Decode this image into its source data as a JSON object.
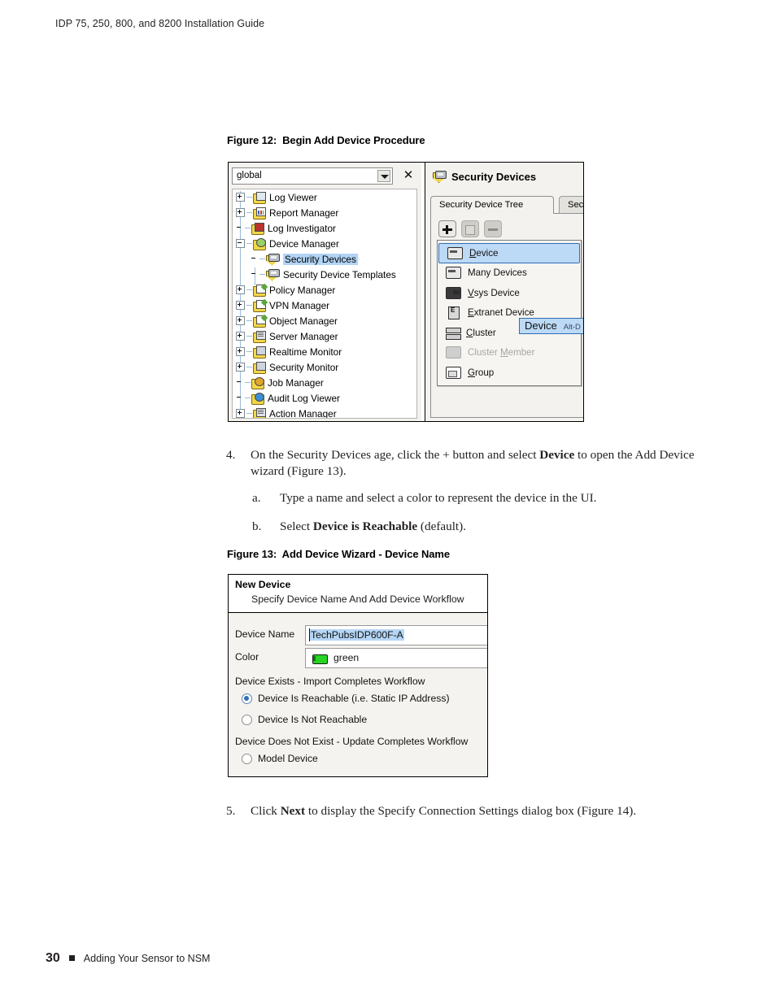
{
  "running_head": "IDP 75, 250, 800, and 8200 Installation Guide",
  "footer": {
    "page_number": "30",
    "section": "Adding Your Sensor to NSM"
  },
  "figure12": {
    "caption": "Figure 12:  Begin Add Device Procedure",
    "domain_selector": {
      "value": "global",
      "dropdown_icon": "chevron-down-icon",
      "close_icon": "close-icon"
    },
    "tree": [
      {
        "label": "Log Viewer",
        "expander": "plus",
        "indent": 1,
        "icon": "log-viewer-icon",
        "selected": false,
        "disabled": false
      },
      {
        "label": "Report Manager",
        "expander": "plus",
        "indent": 1,
        "icon": "report-manager-icon",
        "selected": false,
        "disabled": false
      },
      {
        "label": "Log Investigator",
        "expander": "none",
        "indent": 1,
        "icon": "log-investigator-icon",
        "selected": false,
        "disabled": false
      },
      {
        "label": "Device Manager",
        "expander": "minus",
        "indent": 1,
        "icon": "device-manager-icon",
        "selected": false,
        "disabled": false
      },
      {
        "label": "Security Devices",
        "expander": "none",
        "indent": 2,
        "icon": "security-devices-icon",
        "selected": true,
        "disabled": false
      },
      {
        "label": "Security Device Templates",
        "expander": "none",
        "indent": 2,
        "icon": "security-device-templates-icon",
        "selected": false,
        "disabled": false
      },
      {
        "label": "Policy Manager",
        "expander": "plus",
        "indent": 1,
        "icon": "policy-manager-icon",
        "selected": false,
        "disabled": false
      },
      {
        "label": "VPN Manager",
        "expander": "plus",
        "indent": 1,
        "icon": "vpn-manager-icon",
        "selected": false,
        "disabled": false
      },
      {
        "label": "Object Manager",
        "expander": "plus",
        "indent": 1,
        "icon": "object-manager-icon",
        "selected": false,
        "disabled": false
      },
      {
        "label": "Server Manager",
        "expander": "plus",
        "indent": 1,
        "icon": "server-manager-icon",
        "selected": false,
        "disabled": false
      },
      {
        "label": "Realtime Monitor",
        "expander": "plus",
        "indent": 1,
        "icon": "realtime-monitor-icon",
        "selected": false,
        "disabled": false
      },
      {
        "label": "Security Monitor",
        "expander": "plus",
        "indent": 1,
        "icon": "security-monitor-icon",
        "selected": false,
        "disabled": false
      },
      {
        "label": "Job Manager",
        "expander": "none",
        "indent": 1,
        "icon": "job-manager-icon",
        "selected": false,
        "disabled": false
      },
      {
        "label": "Audit Log Viewer",
        "expander": "none",
        "indent": 1,
        "icon": "audit-log-viewer-icon",
        "selected": false,
        "disabled": false
      },
      {
        "label": "Action Manager",
        "expander": "plus",
        "indent": 1,
        "icon": "action-manager-icon",
        "selected": false,
        "disabled": false
      }
    ],
    "panel": {
      "title": "Security Devices",
      "title_icon": "security-devices-icon",
      "tabs": [
        {
          "label": "Security Device Tree",
          "active": true
        },
        {
          "label": "Securi",
          "active": false
        }
      ],
      "toolbar": [
        {
          "name": "add-button",
          "glyph": "plus-icon",
          "disabled": false
        },
        {
          "name": "edit-button",
          "glyph": "pencil-icon",
          "disabled": true
        },
        {
          "name": "delete-button",
          "glyph": "minus-icon",
          "disabled": true
        }
      ],
      "add_menu": [
        {
          "label": "Device",
          "mnemonic": "D",
          "icon": "device-icon",
          "selected": true,
          "disabled": false
        },
        {
          "label": "Many Devices",
          "mnemonic": "",
          "icon": "many-devices-icon",
          "selected": false,
          "disabled": false
        },
        {
          "label": "Vsys Device",
          "mnemonic": "V",
          "icon": "vsys-device-icon",
          "selected": false,
          "disabled": false
        },
        {
          "label": "Extranet Device",
          "mnemonic": "E",
          "icon": "extranet-device-icon",
          "selected": false,
          "disabled": false
        },
        {
          "label": "Cluster",
          "mnemonic": "C",
          "icon": "cluster-icon",
          "selected": false,
          "disabled": false
        },
        {
          "label": "Cluster Member",
          "mnemonic": "M",
          "icon": "cluster-member-icon",
          "selected": false,
          "disabled": true
        },
        {
          "label": "Group",
          "mnemonic": "G",
          "icon": "group-icon",
          "selected": false,
          "disabled": false
        }
      ],
      "tooltip": {
        "label": "Device",
        "shortcut": "Alt-D"
      }
    }
  },
  "step4": {
    "marker": "4.",
    "text_1": "On the Security Devices age, click the  + button and select ",
    "bold_1": "Device",
    "text_2": " to open the Add Device wizard (Figure 13)."
  },
  "step4a": {
    "marker": "a.",
    "text": "Type a name and select a color to represent the device in the UI."
  },
  "step4b": {
    "marker": "b.",
    "text_1": "Select ",
    "bold_1": "Device is Reachable",
    "text_2": " (default)."
  },
  "step5": {
    "marker": "5.",
    "text_1": "Click ",
    "bold_1": "Next",
    "text_2": " to display the Specify Connection Settings dialog box (Figure 14)."
  },
  "figure13": {
    "caption": "Figure 13:  Add Device Wizard - Device Name",
    "wizard": {
      "title": "New Device",
      "subtitle": "Specify Device Name And Add Device Workflow",
      "fields": [
        {
          "label": "Device Name",
          "value": "TechPubsIDP600F-A",
          "selected": true
        },
        {
          "label": "Color",
          "value": "green",
          "swatch": "#26d426"
        }
      ],
      "group1_label": "Device Exists - Import Completes Workflow",
      "group2_label": "Device Does Not Exist - Update Completes Workflow",
      "radios": [
        {
          "label": "Device Is Reachable (i.e. Static IP Address)",
          "checked": true
        },
        {
          "label": "Device Is Not Reachable",
          "checked": false
        },
        {
          "label": "Model Device",
          "checked": false
        }
      ]
    }
  }
}
